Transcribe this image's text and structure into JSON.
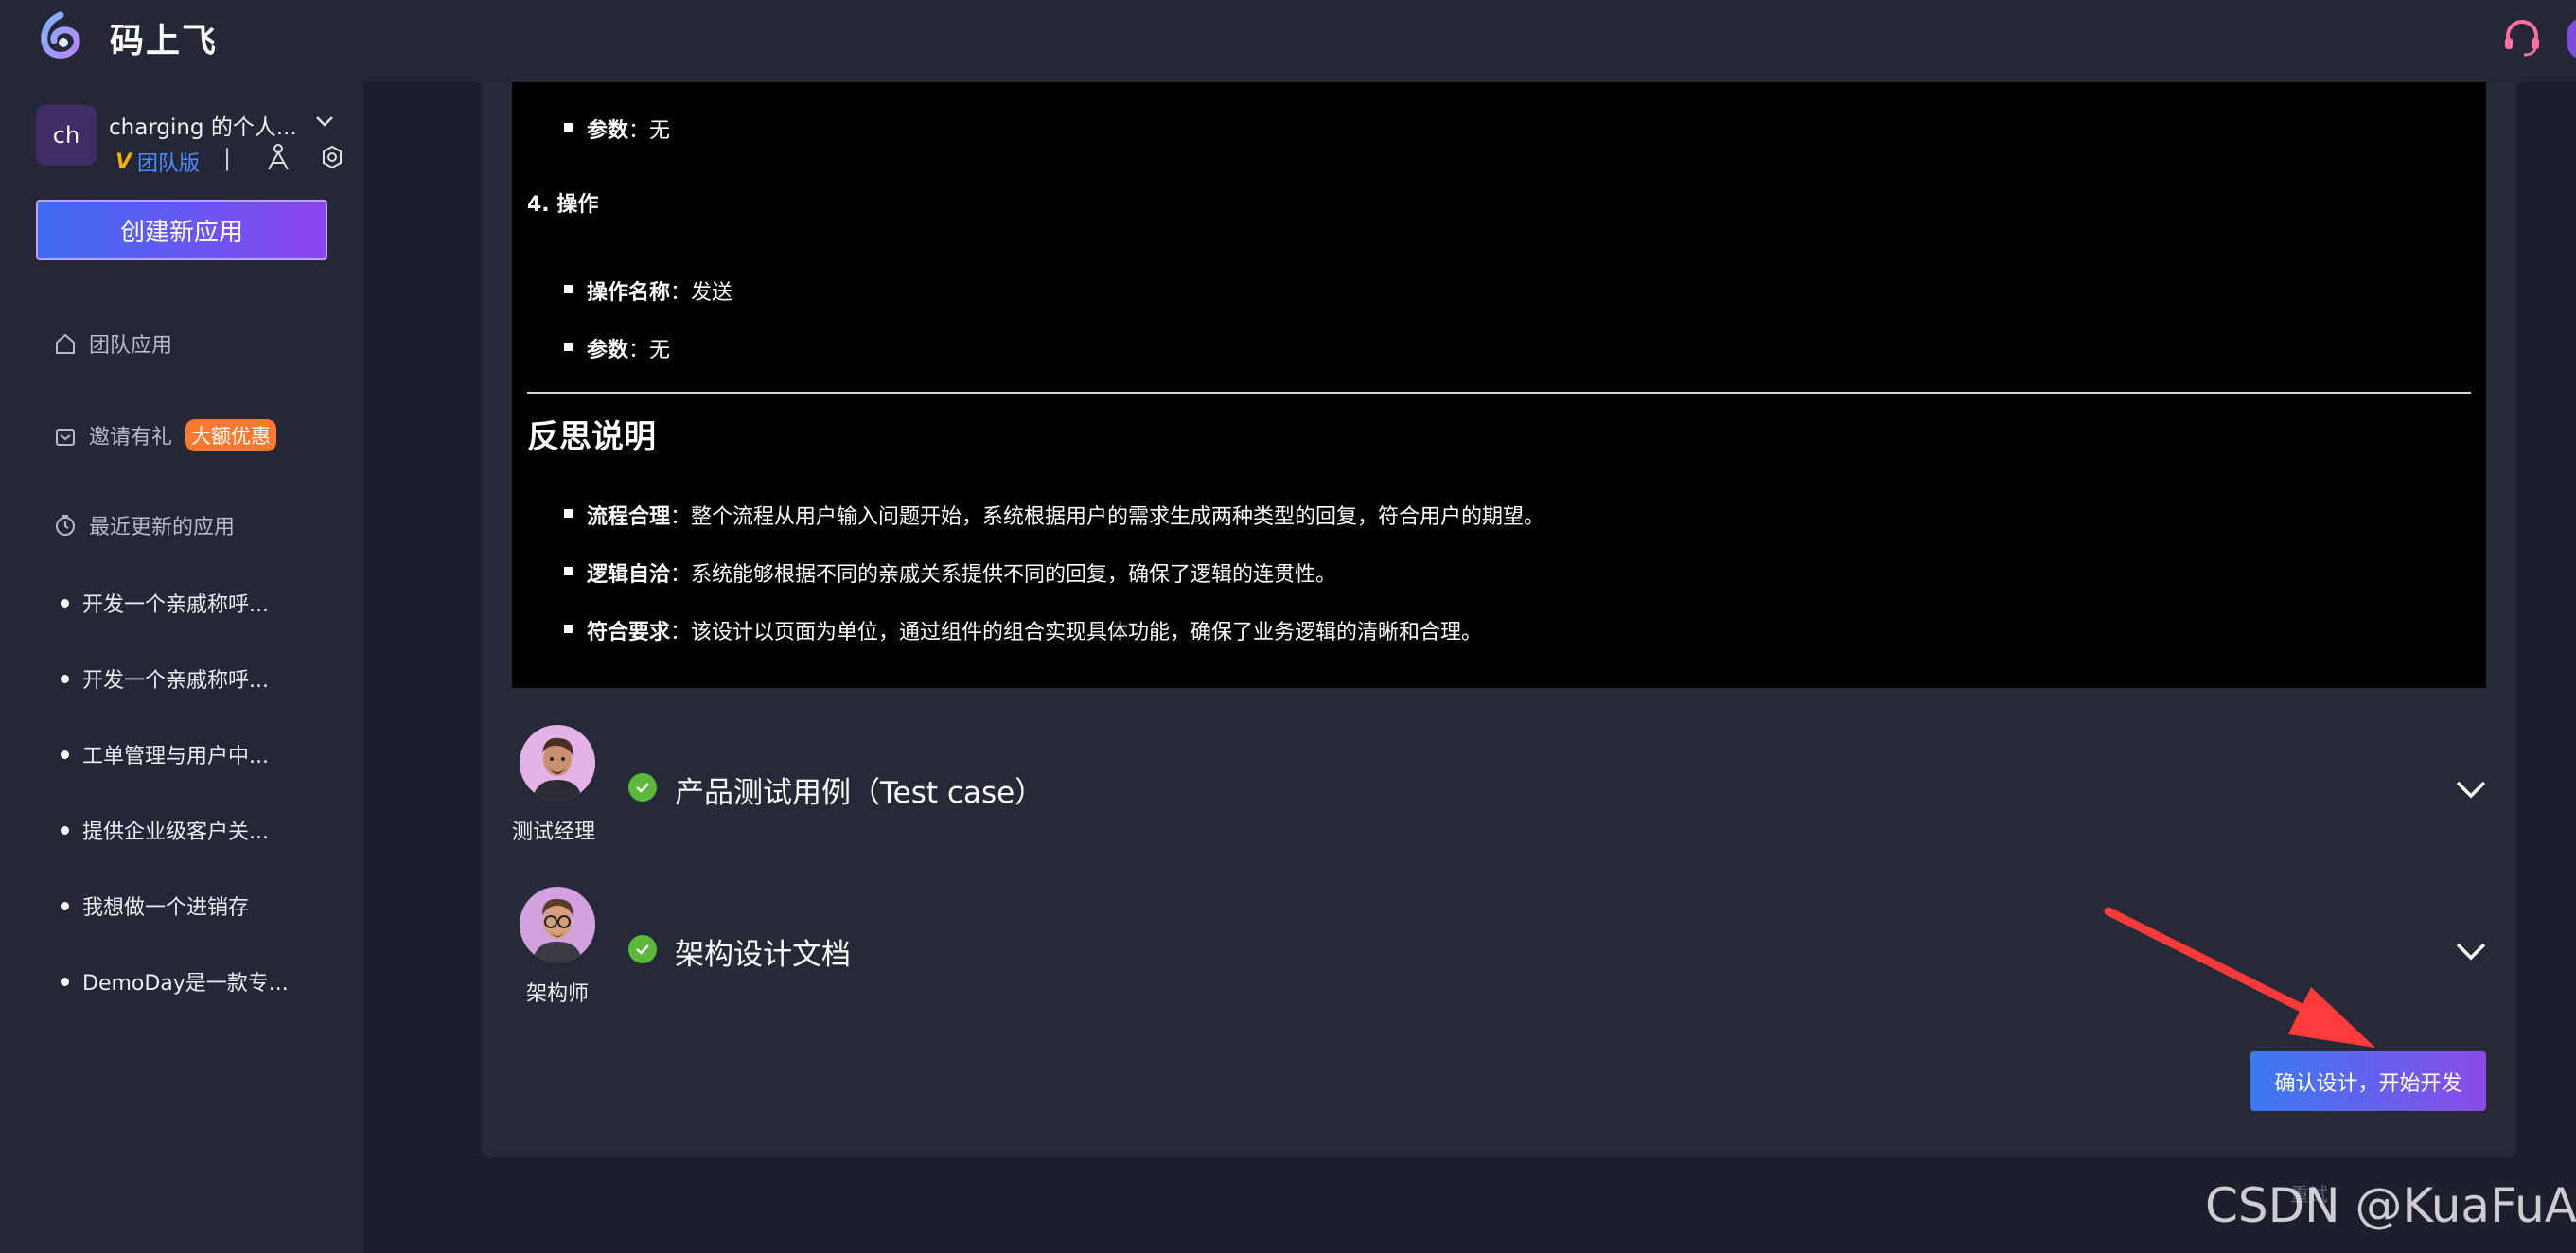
{
  "app": {
    "title": "码上飞"
  },
  "workspace": {
    "avatar_text": "ch",
    "name": "charging 的个人...",
    "edition": "团队版",
    "separator": "|"
  },
  "sidebar": {
    "create_button": "创建新应用",
    "nav": [
      {
        "label": "团队应用",
        "icon": "home-icon"
      },
      {
        "label": "邀请有礼",
        "icon": "gift-icon",
        "badge": "大额优惠"
      },
      {
        "label": "最近更新的应用",
        "icon": "clock-icon"
      }
    ],
    "recent": [
      "开发一个亲戚称呼...",
      "开发一个亲戚称呼...",
      "工单管理与用户中...",
      "提供企业级客户关...",
      "我想做一个进销存",
      "DemoDay是一款专..."
    ]
  },
  "doc": {
    "lines": {
      "param1_key": "参数",
      "param1_val": "：无",
      "op_heading": "4. 操作",
      "opname_key": "操作名称",
      "opname_val": "：发送",
      "param2_key": "参数",
      "param2_val": "：无",
      "reflect_heading": "反思说明",
      "r1_key": "流程合理",
      "r1_val": "：整个流程从用户输入问题开始，系统根据用户的需求生成两种类型的回复，符合用户的期望。",
      "r2_key": "逻辑自洽",
      "r2_val": "：系统能够根据不同的亲戚关系提供不同的回复，确保了逻辑的连贯性。",
      "r3_key": "符合要求",
      "r3_val": "：该设计以页面为单位，通过组件的组合实现具体功能，确保了业务逻辑的清晰和合理。"
    }
  },
  "sections": [
    {
      "role": "测试经理",
      "title": "产品测试用例（Test case）",
      "status": "done"
    },
    {
      "role": "架构师",
      "title": "架构设计文档",
      "status": "done"
    }
  ],
  "confirm_button": "确认设计，开始开发",
  "footer_faint": "重试",
  "watermark": "CSDN @KuaFuAI",
  "colors": {
    "accent_start": "#3e6cf2",
    "accent_end": "#8b45ee",
    "check": "#5cb83b",
    "badge": "#ff7a2e"
  }
}
